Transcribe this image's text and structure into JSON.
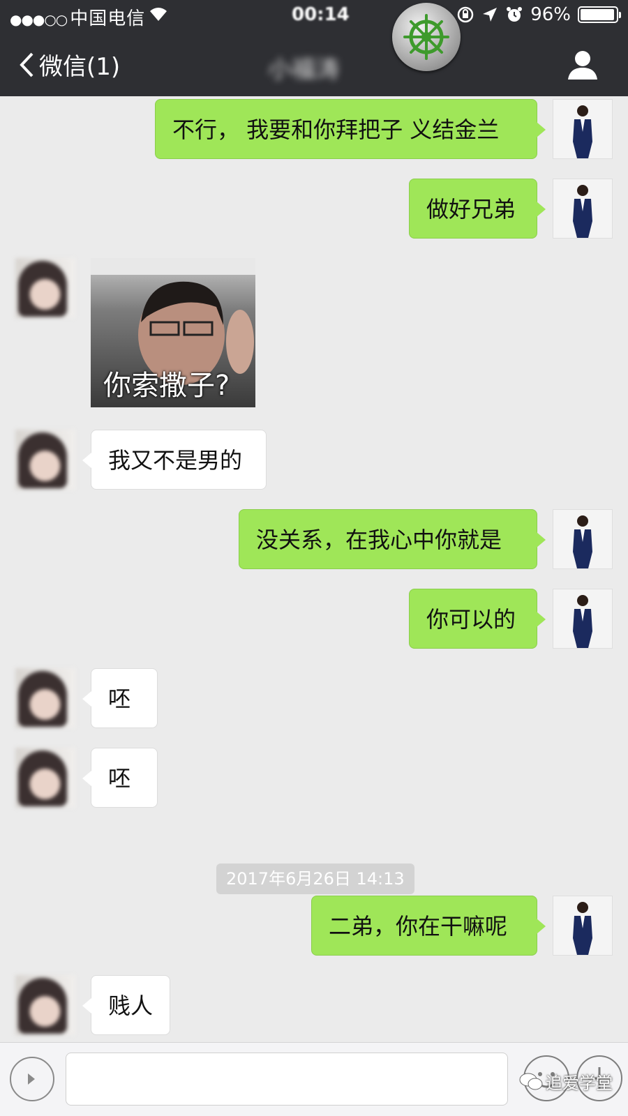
{
  "status_bar": {
    "signal": "●●●○○",
    "carrier": "中国电信",
    "time": "00:14",
    "battery": "96%",
    "battery_level": 0.96
  },
  "nav": {
    "back_label": "微信(1)",
    "chat_title": "小福涛"
  },
  "messages": [
    {
      "side": "me",
      "text": "不行， 我要和你拜把子 义结金兰"
    },
    {
      "side": "me",
      "text": "做好兄弟"
    },
    {
      "side": "them",
      "type": "sticker",
      "text": "你索撒子?"
    },
    {
      "side": "them",
      "text": "我又不是男的"
    },
    {
      "side": "me",
      "text": "没关系，在我心中你就是"
    },
    {
      "side": "me",
      "text": "你可以的"
    },
    {
      "side": "them",
      "text": "呸"
    },
    {
      "side": "them",
      "text": "呸"
    },
    {
      "type": "timestamp",
      "text": "2017年6月26日 14:13"
    },
    {
      "side": "me",
      "text": "二弟，你在干嘛呢"
    },
    {
      "side": "them",
      "text": "贱人"
    }
  ],
  "input_bar": {
    "value": "",
    "watermark": "追爱学堂"
  },
  "colors": {
    "nav_bg": "#2e2f33",
    "chat_bg": "#ebebeb",
    "my_bubble": "#9fe658",
    "their_bubble": "#ffffff"
  }
}
